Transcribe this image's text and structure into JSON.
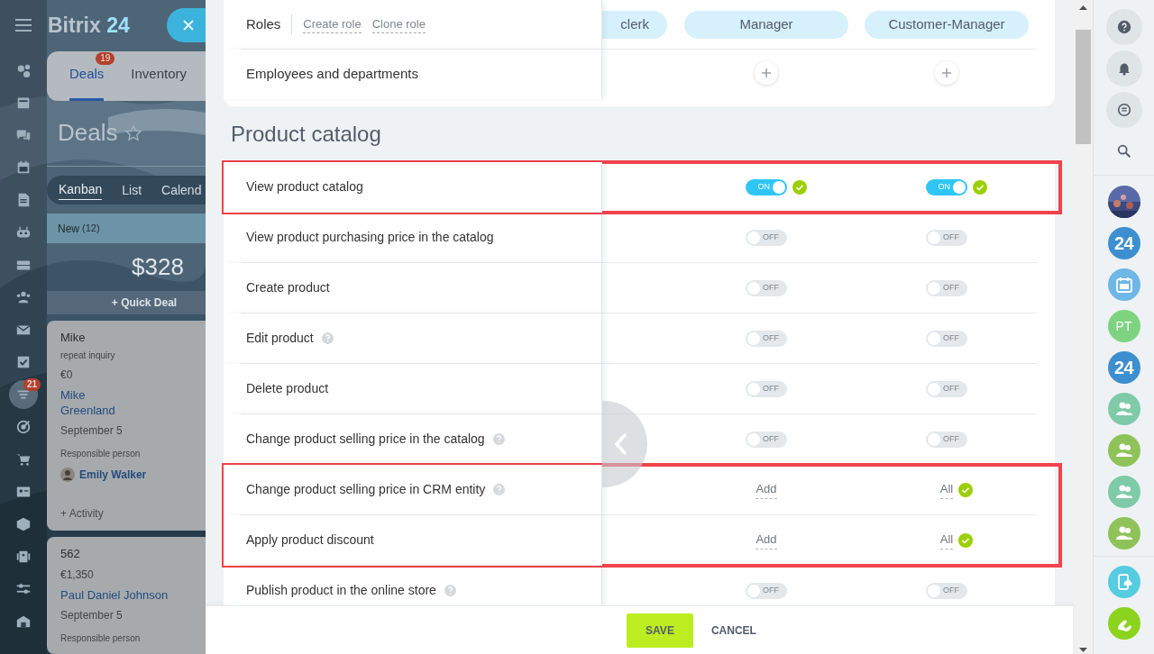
{
  "background_app": {
    "logo": {
      "name": "Bitrix",
      "accent": "24"
    },
    "nav": [
      {
        "kind": "sites",
        "selected": false
      },
      {
        "kind": "feed",
        "selected": false
      },
      {
        "kind": "chat",
        "selected": false
      },
      {
        "kind": "calendar",
        "selected": false
      },
      {
        "kind": "docs",
        "selected": false
      },
      {
        "kind": "robot",
        "selected": false
      },
      {
        "kind": "drive",
        "selected": false
      },
      {
        "kind": "people",
        "selected": false
      },
      {
        "kind": "mail",
        "selected": false
      },
      {
        "kind": "tasks",
        "selected": false
      },
      {
        "kind": "funnel",
        "selected": true,
        "badge": "21"
      },
      {
        "kind": "target",
        "selected": false
      },
      {
        "kind": "cart",
        "selected": false
      },
      {
        "kind": "contact",
        "selected": false
      },
      {
        "kind": "box",
        "selected": false
      },
      {
        "kind": "scanner",
        "selected": false
      },
      {
        "kind": "sliders",
        "selected": false
      },
      {
        "kind": "store",
        "selected": false
      }
    ],
    "tabs": [
      {
        "label": "Deals",
        "badge": "19",
        "selected": true
      },
      {
        "label": "Inventory",
        "selected": false
      }
    ],
    "title": "Deals",
    "views": [
      {
        "label": "Kanban",
        "selected": true
      },
      {
        "label": "List",
        "selected": false
      },
      {
        "label": "Calend",
        "selected": false
      }
    ],
    "column": {
      "name": "New",
      "count": "(12)",
      "total": "$328",
      "quick_add": "+ Quick Deal"
    },
    "cards": [
      {
        "title": "Mike",
        "subtitle": "repeat inquiry",
        "amount": "€0",
        "client": "Mike Greenland",
        "date": "September 5",
        "responsible_label": "Responsible person",
        "responsible": "Emily Walker",
        "action": "+ Activity"
      },
      {
        "title": "562",
        "amount": "€1,350",
        "client": "Paul Daniel Johnson",
        "date": "September 5",
        "responsible_label": "Responsible person"
      }
    ]
  },
  "panel": {
    "roles_label": "Roles",
    "role_actions": [
      "Create role",
      "Clone role"
    ],
    "roles": [
      {
        "name": "clerk",
        "assignable": false
      },
      {
        "name": "Manager",
        "assignable": true
      },
      {
        "name": "Customer-Manager",
        "assignable": true
      }
    ],
    "employees_label": "Employees and departments",
    "section_title": "Product catalog",
    "permissions": [
      {
        "label": "View product catalog",
        "help": false,
        "highlighted": true,
        "cells": [
          {
            "kind": "toggle",
            "on": true,
            "text": "ON",
            "checked": true
          },
          {
            "kind": "toggle",
            "on": true,
            "text": "ON",
            "checked": true
          }
        ]
      },
      {
        "label": "View product purchasing price in the catalog",
        "help": false,
        "highlighted": false,
        "cells": [
          {
            "kind": "toggle",
            "on": false,
            "text": "OFF",
            "checked": false
          },
          {
            "kind": "toggle",
            "on": false,
            "text": "OFF",
            "checked": false
          }
        ]
      },
      {
        "label": "Create product",
        "help": false,
        "highlighted": false,
        "cells": [
          {
            "kind": "toggle",
            "on": false,
            "text": "OFF",
            "checked": false
          },
          {
            "kind": "toggle",
            "on": false,
            "text": "OFF",
            "checked": false
          }
        ]
      },
      {
        "label": "Edit product",
        "help": true,
        "highlighted": false,
        "cells": [
          {
            "kind": "toggle",
            "on": false,
            "text": "OFF",
            "checked": false
          },
          {
            "kind": "toggle",
            "on": false,
            "text": "OFF",
            "checked": false
          }
        ]
      },
      {
        "label": "Delete product",
        "help": false,
        "highlighted": false,
        "cells": [
          {
            "kind": "toggle",
            "on": false,
            "text": "OFF",
            "checked": false
          },
          {
            "kind": "toggle",
            "on": false,
            "text": "OFF",
            "checked": false
          }
        ]
      },
      {
        "label": "Change product selling price in the catalog",
        "help": true,
        "highlighted": false,
        "cells": [
          {
            "kind": "toggle",
            "on": false,
            "text": "OFF",
            "checked": false
          },
          {
            "kind": "toggle",
            "on": false,
            "text": "OFF",
            "checked": false
          }
        ]
      },
      {
        "label": "Change product selling price in CRM entity",
        "help": true,
        "highlighted": true,
        "cells": [
          {
            "kind": "link",
            "text": "Add",
            "checked": false
          },
          {
            "kind": "link",
            "text": "All",
            "checked": true
          }
        ]
      },
      {
        "label": "Apply product discount",
        "help": false,
        "highlighted": true,
        "cells": [
          {
            "kind": "link",
            "text": "Add",
            "checked": false
          },
          {
            "kind": "link",
            "text": "All",
            "checked": true
          }
        ]
      },
      {
        "label": "Publish product in the online store",
        "help": true,
        "highlighted": false,
        "cells": [
          {
            "kind": "toggle",
            "on": false,
            "text": "OFF",
            "checked": false
          },
          {
            "kind": "toggle",
            "on": false,
            "text": "OFF",
            "checked": false
          }
        ]
      }
    ],
    "buttons": [
      {
        "label": "SAVE",
        "kind": "primary"
      },
      {
        "label": "CANCEL",
        "kind": "link"
      }
    ]
  },
  "right_bar": [
    {
      "kind": "help"
    },
    {
      "kind": "bell"
    },
    {
      "kind": "chat"
    },
    {
      "kind": "search"
    },
    {
      "kind": "avatar"
    },
    {
      "kind": "badge",
      "text": "24",
      "color": "#3d8fd0"
    },
    {
      "kind": "calendar",
      "color": "#6fb7e6"
    },
    {
      "kind": "badge",
      "text": "PT",
      "color": "#7ed380"
    },
    {
      "kind": "badge",
      "text": "24",
      "color": "#3d8fd0"
    },
    {
      "kind": "group",
      "color": "#7fcaa8"
    },
    {
      "kind": "group",
      "color": "#8fc35a"
    },
    {
      "kind": "group",
      "color": "#7fcaa8"
    },
    {
      "kind": "group",
      "color": "#8fc35a"
    },
    {
      "kind": "phone-cloud",
      "color": "#55cce0"
    },
    {
      "kind": "phone",
      "color": "#8bd31c"
    }
  ]
}
